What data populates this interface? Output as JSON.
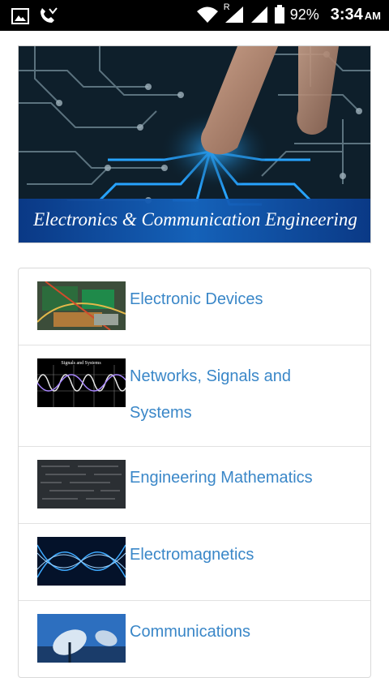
{
  "status_bar": {
    "battery_percent": "92%",
    "time": "3:34",
    "ampm": "AM",
    "roaming": "R",
    "icons": [
      "image-icon",
      "missed-call-icon",
      "wifi-icon",
      "signal-icon",
      "signal-icon",
      "battery-icon"
    ]
  },
  "banner": {
    "title": "Electronics & Communication Engineering"
  },
  "subjects": [
    {
      "label": "Electronic Devices",
      "thumb": "circuit-board-thumbnail"
    },
    {
      "label": "Networks, Signals and Systems",
      "thumb": "signals-and-systems-thumbnail",
      "thumb_caption": "Signals and Systems"
    },
    {
      "label": "Engineering Mathematics",
      "thumb": "math-formulas-thumbnail"
    },
    {
      "label": "Electromagnetics",
      "thumb": "waves-thumbnail"
    },
    {
      "label": "Communications",
      "thumb": "satellite-dish-thumbnail"
    }
  ]
}
